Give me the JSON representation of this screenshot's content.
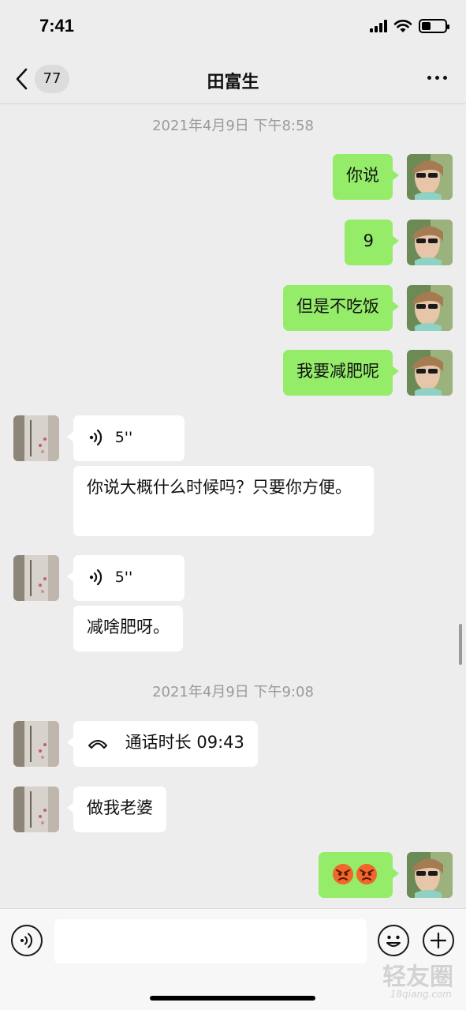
{
  "status_bar": {
    "time": "7:41"
  },
  "nav": {
    "back_count": "77",
    "title": "田富生"
  },
  "messages": {
    "ts1": "2021年4月9日 下午8:58",
    "m1": "你说",
    "m2": "9",
    "m3": "但是不吃饭",
    "m4": "我要减肥呢",
    "v1": "5''",
    "m5": "你说大概什么时候吗？只要你方便。",
    "v2": "5''",
    "m6": "减啥肥呀。",
    "ts2": "2021年4月9日 下午9:08",
    "call": "通话时长 09:43",
    "m7": "做我老婆"
  },
  "icons": {
    "back": "chevron-left-icon",
    "more": "more-dots-icon",
    "voice": "voice-wave-icon",
    "phone": "phone-hangup-icon",
    "emoji_reaction": "angry-face-emoji",
    "voice_toggle": "voice-input-icon",
    "emoji_button": "smiley-icon",
    "plus": "plus-icon"
  },
  "colors": {
    "sent_bubble": "#95ec69",
    "received_bubble": "#ffffff",
    "background": "#ededed"
  },
  "watermark": {
    "main": "轻友圈",
    "sub": "18qiang.com"
  }
}
